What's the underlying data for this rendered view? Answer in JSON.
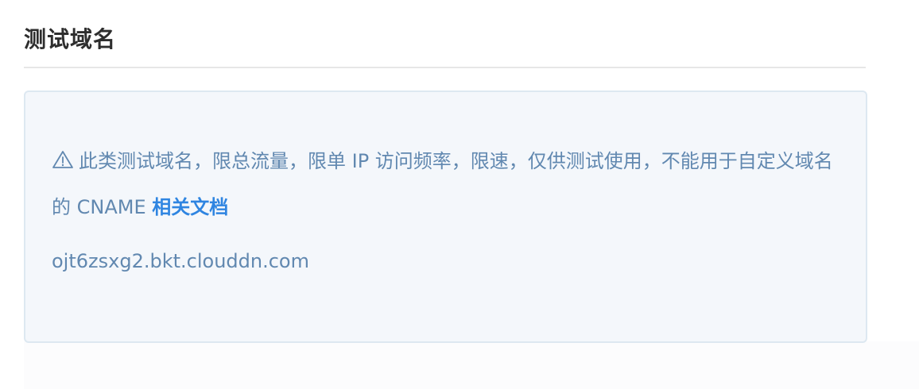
{
  "section": {
    "title": "测试域名"
  },
  "notice": {
    "icon": "warning-triangle-icon",
    "text": "此类测试域名，限总流量，限单 IP 访问频率，限速，仅供测试使用，不能用于自定义域名的 CNAME",
    "link_label": "相关文档"
  },
  "test_domain": {
    "value": "ojt6zsxg2.bkt.clouddn.com"
  },
  "colors": {
    "box_background": "#f4f7fb",
    "box_border": "#dde8f1",
    "text": "#6188b0",
    "link": "#2f85e1",
    "title": "#2e2e2e"
  }
}
